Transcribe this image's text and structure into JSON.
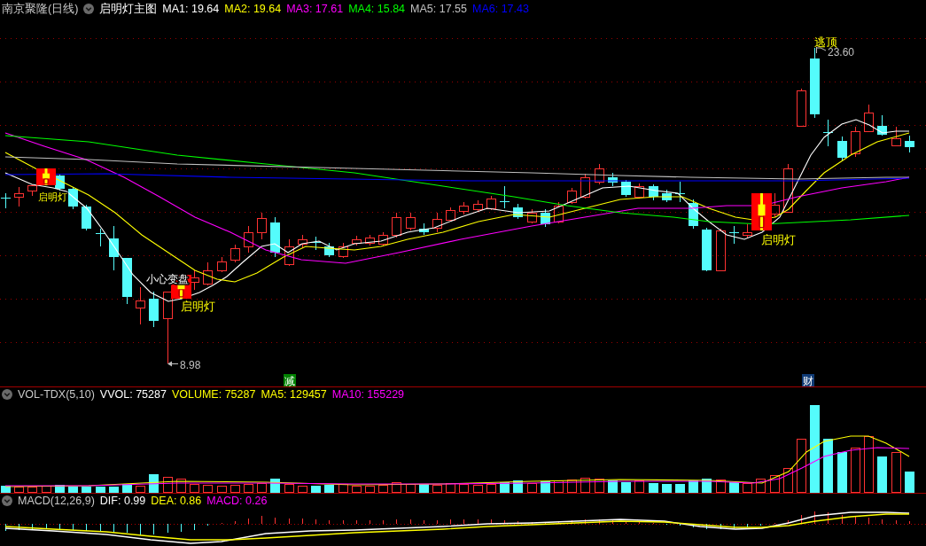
{
  "header": {
    "security": "南京聚隆(日线)",
    "indicator": "启明灯主图",
    "averages": [
      {
        "label": "MA1: 19.64",
        "color": "#ffffff"
      },
      {
        "label": "MA2: 19.64",
        "color": "#ffff00"
      },
      {
        "label": "MA3: 17.61",
        "color": "#ff00ff"
      },
      {
        "label": "MA4: 15.84",
        "color": "#00ff00"
      },
      {
        "label": "MA5: 17.55",
        "color": "#c0c0c0"
      },
      {
        "label": "MA6: 17.43",
        "color": "#0000ff"
      }
    ]
  },
  "price_chart": {
    "signals": [
      {
        "label": "启明灯"
      },
      {
        "label": "启明灯"
      },
      {
        "label": "启明灯"
      }
    ],
    "warning": "小心变盘",
    "top_signal": "逃顶",
    "high": "23.60",
    "low": "8.98",
    "tags": [
      {
        "text": "减",
        "color": "#008000"
      },
      {
        "text": "财",
        "color": "#0f3a74"
      }
    ]
  },
  "volume": {
    "name": "VOL-TDX(5,10)",
    "readings": [
      {
        "label": "VVOL: 75287",
        "color": "#ffffff"
      },
      {
        "label": "VOLUME: 75287",
        "color": "#ffff00"
      },
      {
        "label": "MA5: 129457",
        "color": "#ffff00"
      },
      {
        "label": "MA10: 155229",
        "color": "#ff00ff"
      }
    ]
  },
  "macd": {
    "name": "MACD(12,26,9)",
    "readings": [
      {
        "label": "DIF: 0.99",
        "color": "#ffffff"
      },
      {
        "label": "DEA: 0.86",
        "color": "#ffff00"
      },
      {
        "label": "MACD: 0.26",
        "color": "#ff00ff"
      }
    ]
  }
}
